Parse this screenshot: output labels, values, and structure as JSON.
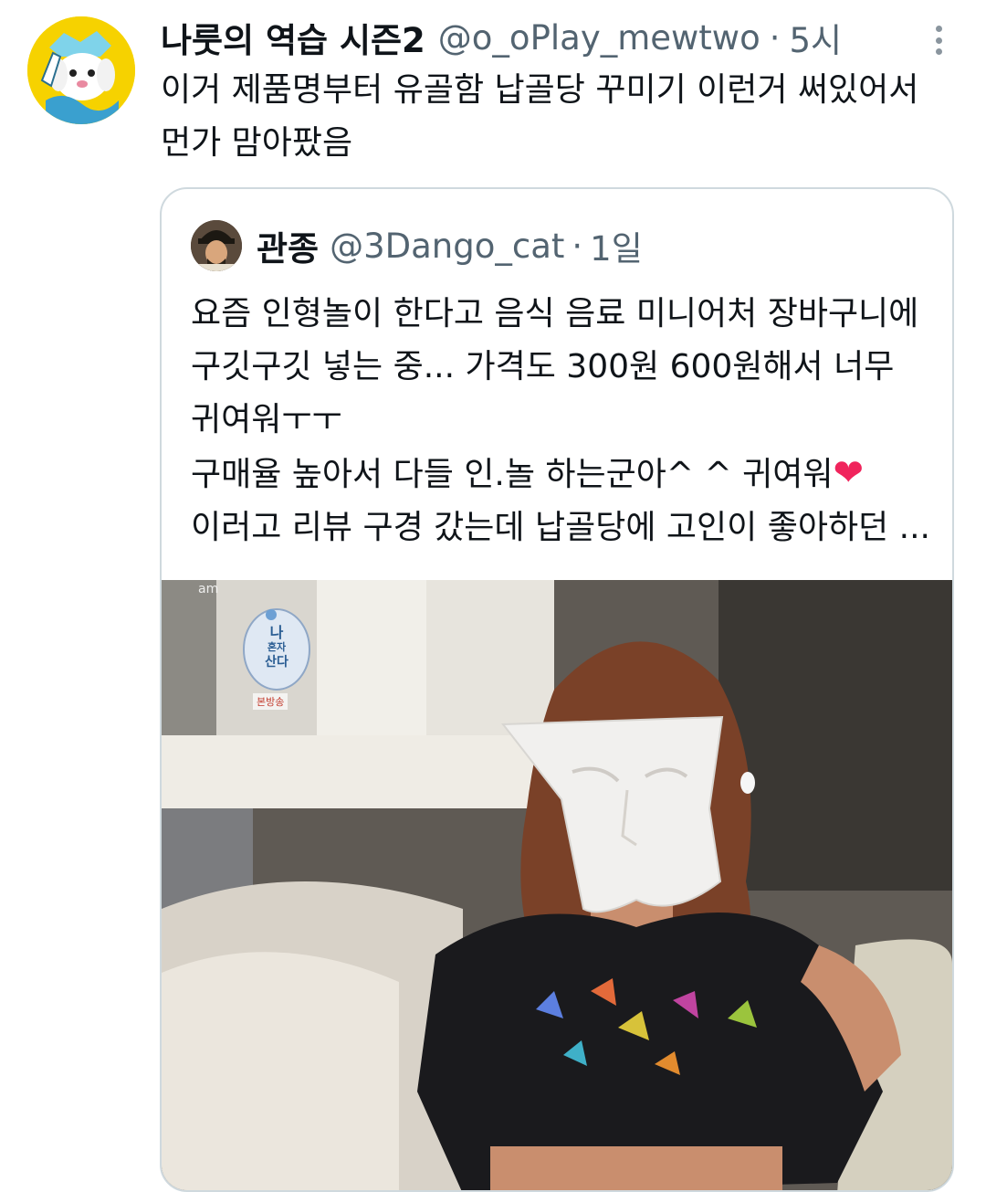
{
  "tweet": {
    "author_name": "나룻의 역습 시즌2",
    "author_handle": "@o_oPlay_mewtwo",
    "separator": "·",
    "time": "5시",
    "text_lines": [
      "이거 제품명부터 유골함 납골당 꾸미기 이런거 써있어서",
      "먼가 맘아팠음"
    ],
    "avatar_icon": "cartoon-puppy-avatar",
    "more_icon": "vertical-ellipsis-icon"
  },
  "quoted": {
    "author_name": "관종",
    "author_handle": "@3Dango_cat",
    "separator": "·",
    "time": "1일",
    "lines": [
      "요즘 인형놀이 한다고 음식 음료 미니어처 장바구니에",
      "구깃구깃 넣는 중...  가격도 300원 600원해서 너무",
      "귀여워ㅜㅜ",
      "구매율 높아서 다들 인.놀 하는군아^ ^ 귀여워",
      "이러고 리뷰 구경 갔는데 납골당에 고인이 좋아하던 ..."
    ],
    "heart_emoji": "❤",
    "avatar_icon": "historical-drama-actor-avatar",
    "media": {
      "description_icon": "tv-show-still-woman-with-paper-face-cover",
      "broadcast_logo_text": [
        "나",
        "혼자",
        "산다"
      ],
      "rerun_badge": "본방송",
      "watermark": "am"
    }
  },
  "colors": {
    "text": "#0f1419",
    "secondary": "#536471",
    "border": "#cfd9de",
    "heart": "#f0245c"
  }
}
